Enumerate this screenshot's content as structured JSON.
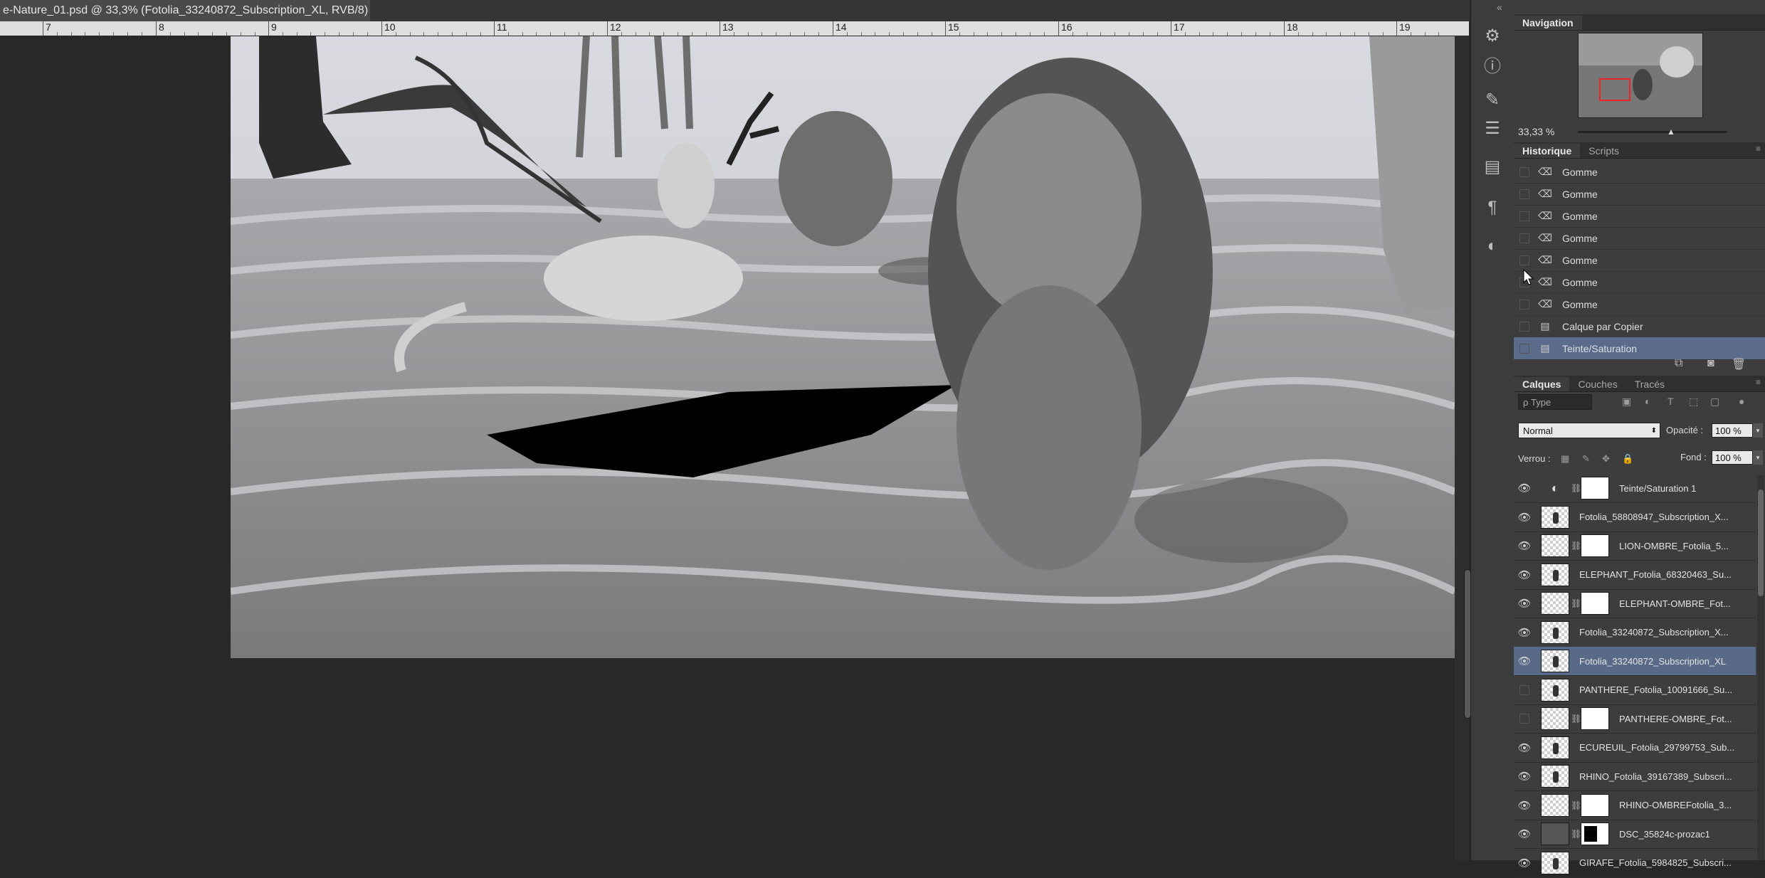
{
  "document": {
    "tab_title": "e-Nature_01.psd @ 33,3% (Fotolia_33240872_Subscription_XL, RVB/8) *",
    "close_glyph": "×"
  },
  "ruler": {
    "labels": [
      "7",
      "8",
      "9",
      "10",
      "11",
      "12",
      "13",
      "14",
      "15",
      "16",
      "17",
      "18",
      "19"
    ]
  },
  "toolstrip": {
    "collapse_glyph": "«",
    "icons": [
      "gear-adjust-icon",
      "info-icon",
      "brush-presets-icon",
      "sliders-icon",
      "layer-comps-icon",
      "paragraph-icon",
      "adjustment-circle-icon"
    ]
  },
  "navigation": {
    "tab": "Navigation",
    "zoom": "33,33 %"
  },
  "history": {
    "tabs": [
      "Historique",
      "Scripts"
    ],
    "items": [
      {
        "label": "Gomme",
        "icon": "eraser-icon"
      },
      {
        "label": "Gomme",
        "icon": "eraser-icon"
      },
      {
        "label": "Gomme",
        "icon": "eraser-icon"
      },
      {
        "label": "Gomme",
        "icon": "eraser-icon"
      },
      {
        "label": "Gomme",
        "icon": "eraser-icon"
      },
      {
        "label": "Gomme",
        "icon": "eraser-icon"
      },
      {
        "label": "Gomme",
        "icon": "eraser-icon"
      },
      {
        "label": "Calque par Copier",
        "icon": "layer-doc-icon"
      },
      {
        "label": "Teinte/Saturation",
        "icon": "layer-doc-icon"
      }
    ],
    "selected_index": 8
  },
  "layers": {
    "tabs": [
      "Calques",
      "Couches",
      "Tracés"
    ],
    "filter_label": "ρ Type",
    "blend_mode": "Normal",
    "opacity_label": "Opacité :",
    "opacity_value": "100 %",
    "lock_label": "Verrou :",
    "fill_label": "Fond :",
    "fill_value": "100 %",
    "items": [
      {
        "name": "Teinte/Saturation 1",
        "visible": true,
        "kind": "adjustment"
      },
      {
        "name": "Fotolia_58808947_Subscription_X...",
        "visible": true,
        "kind": "layer"
      },
      {
        "name": "LION-OMBRE_Fotolia_5...",
        "visible": true,
        "kind": "masked"
      },
      {
        "name": "ELEPHANT_Fotolia_68320463_Su...",
        "visible": true,
        "kind": "layer"
      },
      {
        "name": "ELEPHANT-OMBRE_Fot...",
        "visible": true,
        "kind": "masked"
      },
      {
        "name": "Fotolia_33240872_Subscription_X...",
        "visible": true,
        "kind": "layer"
      },
      {
        "name": "Fotolia_33240872_Subscription_XL",
        "visible": true,
        "kind": "layer",
        "selected": true
      },
      {
        "name": "PANTHERE_Fotolia_10091666_Su...",
        "visible": false,
        "kind": "layer"
      },
      {
        "name": "PANTHERE-OMBRE_Fot...",
        "visible": false,
        "kind": "masked"
      },
      {
        "name": "ECUREUIL_Fotolia_29799753_Sub...",
        "visible": true,
        "kind": "layer"
      },
      {
        "name": "RHINO_Fotolia_39167389_Subscri...",
        "visible": true,
        "kind": "layer"
      },
      {
        "name": "RHINO-OMBREFotolia_3...",
        "visible": true,
        "kind": "masked"
      },
      {
        "name": "DSC_35824c-prozac1",
        "visible": true,
        "kind": "photo-masked"
      },
      {
        "name": "GIRAFE_Fotolia_5984825_Subscri...",
        "visible": true,
        "kind": "layer"
      }
    ]
  }
}
